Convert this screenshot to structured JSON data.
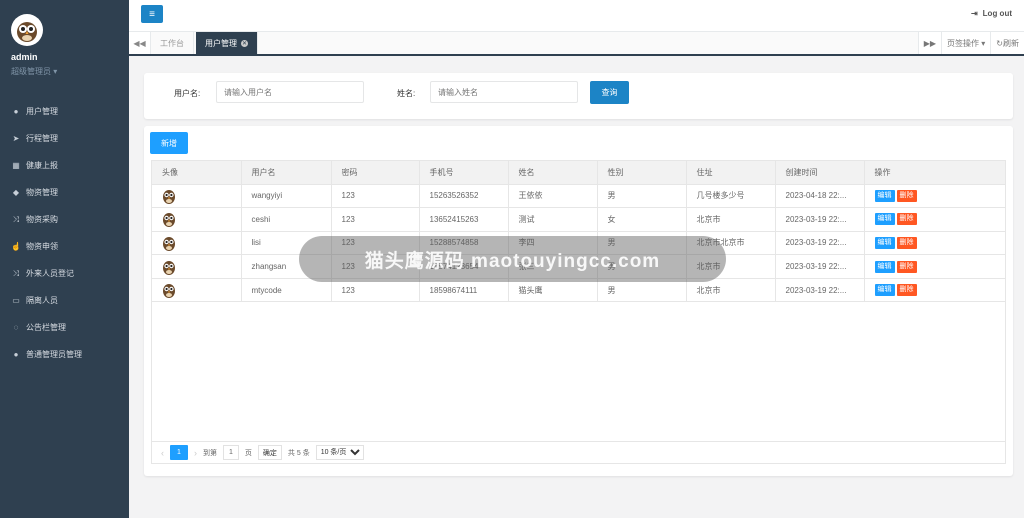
{
  "sidebar": {
    "user_name": "admin",
    "user_role": "超级管理员",
    "items": [
      {
        "label": "用户管理",
        "icon": "user-icon"
      },
      {
        "label": "行程管理",
        "icon": "send-icon"
      },
      {
        "label": "健康上报",
        "icon": "calendar-icon"
      },
      {
        "label": "物资管理",
        "icon": "box-icon"
      },
      {
        "label": "物资采购",
        "icon": "shuffle-icon"
      },
      {
        "label": "物资申领",
        "icon": "hand-icon"
      },
      {
        "label": "外来人员登记",
        "icon": "shuffle-icon"
      },
      {
        "label": "隔离人员",
        "icon": "card-icon"
      },
      {
        "label": "公告栏管理",
        "icon": "chat-icon"
      },
      {
        "label": "普通管理员管理",
        "icon": "user-icon"
      }
    ]
  },
  "header": {
    "logout_label": "Log out"
  },
  "tabs": {
    "items": [
      {
        "label": "工作台"
      },
      {
        "label": "用户管理"
      }
    ],
    "tab_ops_label": "页签操作",
    "refresh_label": "刷新"
  },
  "search": {
    "username_label": "用户名:",
    "username_placeholder": "请输入用户名",
    "name_label": "姓名:",
    "name_placeholder": "请输入姓名",
    "query_label": "查询"
  },
  "table": {
    "add_label": "新增",
    "headers": [
      "头像",
      "用户名",
      "密码",
      "手机号",
      "姓名",
      "性别",
      "住址",
      "创建时间",
      "操作"
    ],
    "edit_label": "编辑",
    "delete_label": "删除",
    "rows": [
      {
        "username": "wangyiyi",
        "password": "123",
        "phone": "15263526352",
        "name": "王依依",
        "gender": "男",
        "address": "几号楼多少号",
        "created": "2023-04-18 22:..."
      },
      {
        "username": "ceshi",
        "password": "123",
        "phone": "13652415263",
        "name": "测试",
        "gender": "女",
        "address": "北京市",
        "created": "2023-03-19 22:..."
      },
      {
        "username": "lisi",
        "password": "123",
        "phone": "15288574858",
        "name": "李四",
        "gender": "男",
        "address": "北京市北京市",
        "created": "2023-03-19 22:..."
      },
      {
        "username": "zhangsan",
        "password": "123",
        "phone": "18574123654",
        "name": "张三",
        "gender": "男",
        "address": "北京市",
        "created": "2023-03-19 22:..."
      },
      {
        "username": "mtycode",
        "password": "123",
        "phone": "18598674111",
        "name": "猫头鹰",
        "gender": "男",
        "address": "北京市",
        "created": "2023-03-19 22:..."
      }
    ]
  },
  "pager": {
    "current_page": "1",
    "goto_prefix": "到第",
    "goto_value": "1",
    "goto_suffix": "页",
    "confirm_label": "确定",
    "total_label": "共 5 条",
    "page_size_label": "10 条/页"
  },
  "watermark": {
    "text": "猫头鹰源码 maotouyingcc.com"
  },
  "colors": {
    "sidebar": "#2f4050",
    "primary": "#1c84c6",
    "edit": "#1e9fff",
    "delete": "#ff5722"
  }
}
